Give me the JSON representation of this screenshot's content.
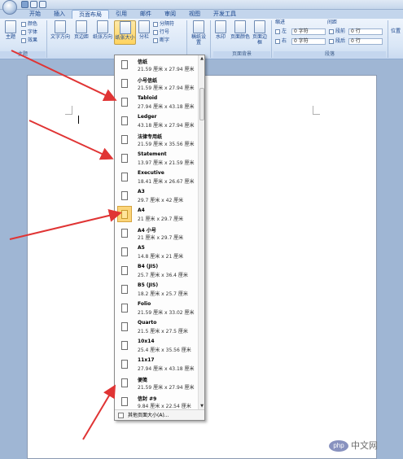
{
  "tabs": [
    "开始",
    "插入",
    "页面布局",
    "引用",
    "邮件",
    "审阅",
    "视图",
    "开发工具"
  ],
  "ribbon": {
    "theme_label": "主题",
    "colors_label": "颜色",
    "fonts_label": "字体",
    "effects_label": "效果",
    "group_theme": "主题",
    "text_direction": "文字方向",
    "margins": "页边距",
    "orientation": "纸张方向",
    "size": "纸张大小",
    "columns": "分栏",
    "breaks": "分隔符",
    "line_numbers": "行号",
    "hyphenation": "断字",
    "page_setup_btn": "稿纸设置",
    "watermark": "水印",
    "page_color": "页面颜色",
    "page_borders": "页面边框",
    "group_page_bg": "页面背景",
    "indent_title": "缩进",
    "spacing_title": "间距",
    "indent_left_label": "左",
    "indent_right_label": "右",
    "indent_left_value": "0 字符",
    "indent_right_value": "0 字符",
    "spacing_before_label": "段前",
    "spacing_after_label": "段后",
    "spacing_before_value": "0 行",
    "spacing_after_value": "0 行",
    "group_paragraph": "段落",
    "position_label": "位置"
  },
  "paper_sizes": [
    {
      "name": "信纸",
      "size": "21.59 厘米 x 27.94 厘米"
    },
    {
      "name": "小号信纸",
      "size": "21.59 厘米 x 27.94 厘米"
    },
    {
      "name": "Tabloid",
      "size": "27.94 厘米 x 43.18 厘米"
    },
    {
      "name": "Ledger",
      "size": "43.18 厘米 x 27.94 厘米"
    },
    {
      "name": "法律专用纸",
      "size": "21.59 厘米 x 35.56 厘米"
    },
    {
      "name": "Statement",
      "size": "13.97 厘米 x 21.59 厘米"
    },
    {
      "name": "Executive",
      "size": "18.41 厘米 x 26.67 厘米"
    },
    {
      "name": "A3",
      "size": "29.7 厘米 x 42 厘米"
    },
    {
      "name": "A4",
      "size": "21 厘米 x 29.7 厘米"
    },
    {
      "name": "A4 小号",
      "size": "21 厘米 x 29.7 厘米"
    },
    {
      "name": "A5",
      "size": "14.8 厘米 x 21 厘米"
    },
    {
      "name": "B4 (JIS)",
      "size": "25.7 厘米 x 36.4 厘米"
    },
    {
      "name": "B5 (JIS)",
      "size": "18.2 厘米 x 25.7 厘米"
    },
    {
      "name": "Folio",
      "size": "21.59 厘米 x 33.02 厘米"
    },
    {
      "name": "Quarto",
      "size": "21.5 厘米 x 27.5 厘米"
    },
    {
      "name": "10x14",
      "size": "25.4 厘米 x 35.56 厘米"
    },
    {
      "name": "11x17",
      "size": "27.94 厘米 x 43.18 厘米"
    },
    {
      "name": "便笺",
      "size": "21.59 厘米 x 27.94 厘米"
    },
    {
      "name": "信封 #9",
      "size": "9.84 厘米 x 22.54 厘米"
    }
  ],
  "selected_paper": "A4",
  "more_sizes_label": "其他页面大小(A)...",
  "watermark_text": "中文网",
  "watermark_logo": "php",
  "colors": {
    "accent_arrow": "#e03434",
    "selected": "#fbd57a"
  }
}
